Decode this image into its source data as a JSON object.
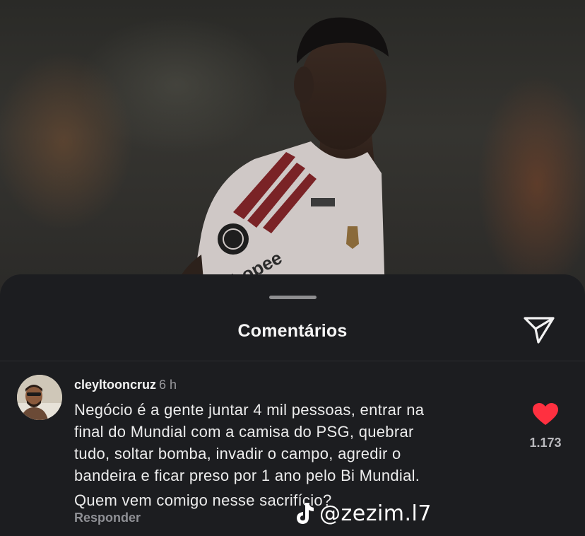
{
  "sheet": {
    "title": "Comentários",
    "send_icon": "paper-plane-icon"
  },
  "comment": {
    "username": "cleyltooncruz",
    "time": "6 h",
    "lines": [
      "Negócio é a gente juntar 4 mil pessoas, entrar na",
      "final do Mundial com a camisa do PSG, quebrar",
      "tudo, soltar bomba, invadir o campo, agredir o",
      "bandeira e ficar preso por 1 ano pelo Bi Mundial.",
      "Quem vem comigo nesse sacrifício?"
    ],
    "reply_label": "Responder",
    "like_count": "1.173",
    "liked": true,
    "like_color": "#ff3040"
  },
  "photo": {
    "jersey_text": "hopee"
  },
  "watermark": {
    "icon": "tiktok-icon",
    "handle": "@zezim.l7"
  }
}
